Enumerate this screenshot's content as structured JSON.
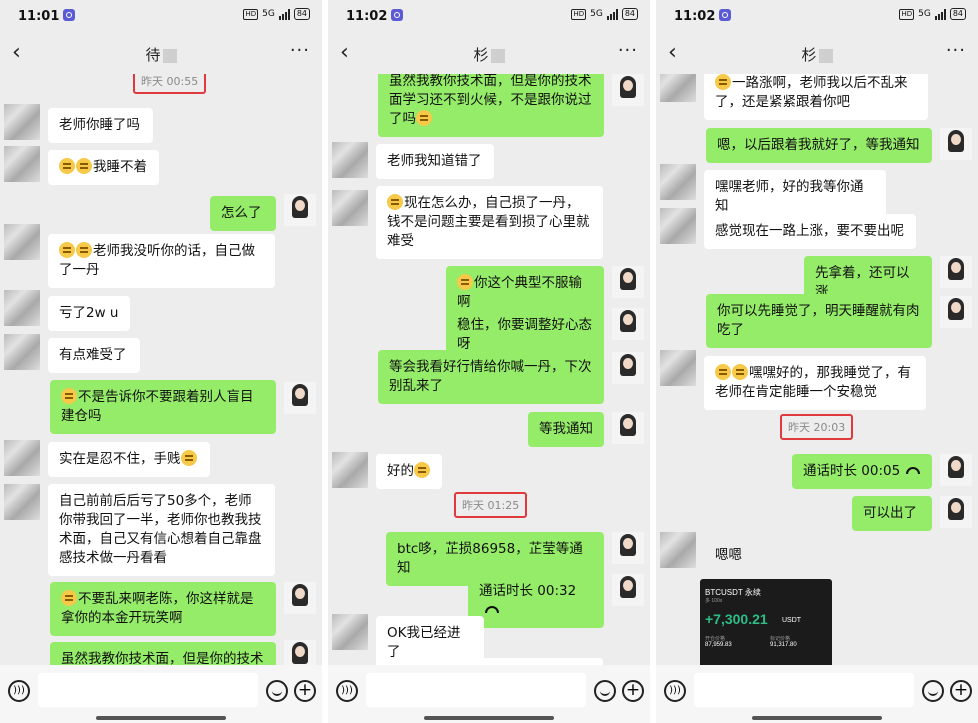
{
  "status_bar": [
    {
      "time": "11:01",
      "battery": "84",
      "network": "5G"
    },
    {
      "time": "11:02",
      "battery": "84",
      "network": "5G"
    },
    {
      "time": "11:02",
      "battery": "84",
      "network": "5G"
    }
  ],
  "titles": [
    "待",
    "杉",
    "杉"
  ],
  "panel1": {
    "stamp": "昨天 00:55",
    "m1": "老师你睡了吗",
    "m2": "我睡不着",
    "m3": "怎么了",
    "m4": "老师我没听你的话，自己做了一丹",
    "m5": "亏了2w u",
    "m6": "有点难受了",
    "m7": "不是告诉你不要跟着别人盲目建仓吗",
    "m8": "实在是忍不住，手贱",
    "m9": "自己前前后后亏了50多个，老师你带我回了一半，老师你也教我技术面，自己又有信心想着自己靠盘感技术做一丹看看",
    "m10": "不要乱来啊老陈，你这样就是拿你的本金开玩笑啊",
    "m11": "虽然我教你技术面，但是你的技术"
  },
  "panel2": {
    "m1": "虽然我教你技术面，但是你的技术面学习还不到火候，不是跟你说过了吗",
    "m2": "老师我知道错了",
    "m3": "现在怎么办，自己损了一丹，钱不是问题主要是看到损了心里就难受",
    "m4": "你这个典型不服输啊",
    "m5": "稳住，你要调整好心态呀",
    "m6": "等会我看好行情给你喊一丹，下次别乱来了",
    "m7": "等我通知",
    "m8": "好的",
    "stamp": "昨天 01:25",
    "m9": "btc哆，芷损86958，芷莹等通知",
    "m10": "通话时长 00:32",
    "m11": "OK我已经进了"
  },
  "panel3": {
    "m1": "一路涨啊，老师我以后不乱来了，还是紧紧跟着你吧",
    "m2": "嗯，以后跟着我就好了，等我通知",
    "m3": "嘿嘿老师，好的我等你通知",
    "m4": "感觉现在一路上涨，要不要出呢",
    "m5": "先拿着，还可以涨",
    "m6": "你可以先睡觉了，明天睡醒就有肉吃了",
    "m7": "嘿嘿好的，那我睡觉了，有老师在肯定能睡一个安稳觉",
    "stamp": "昨天 20:03",
    "m8": "通话时长 00:05",
    "m9": "可以出了",
    "m10": "嗯嗯",
    "card": {
      "pair": "BTCUSDT 永续",
      "sub": "多 100x",
      "pnl": "+7,300.21",
      "unit": "USDT",
      "label1": "开仓价格",
      "value1": "87,959.83",
      "label2": "标记价格",
      "value2": "91,317.80"
    }
  },
  "icons": [
    "back-icon",
    "more-icon",
    "voice-icon",
    "emoji-icon",
    "plus-icon",
    "call-icon"
  ]
}
